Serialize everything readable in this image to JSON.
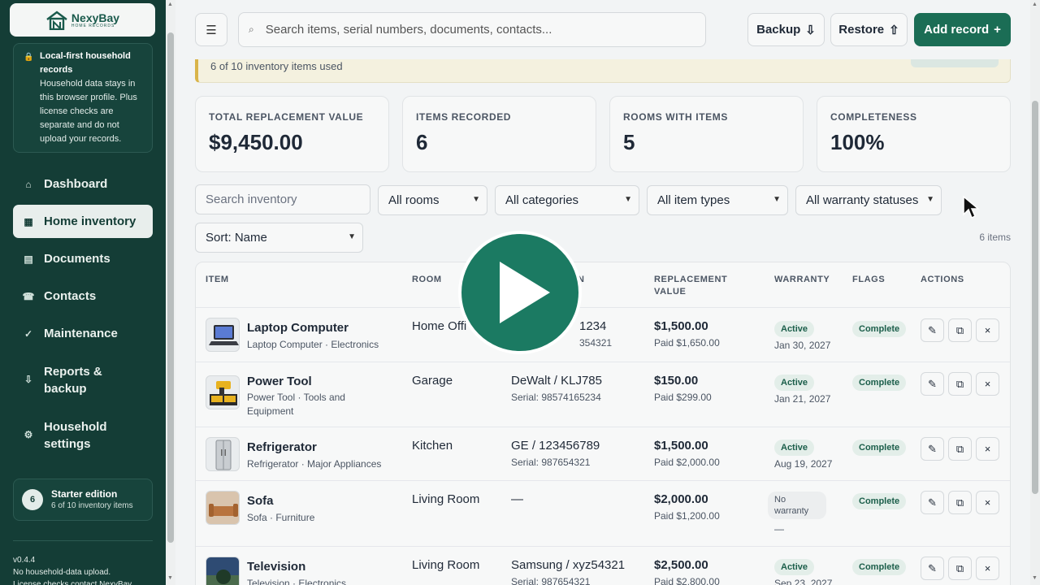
{
  "brand": {
    "name": "NexyBay",
    "sub": "HOME RECORDS"
  },
  "notice": {
    "title": "Local-first household records",
    "body": "Household data stays in this browser profile. Plus license checks are separate and do not upload your records."
  },
  "nav": [
    {
      "label": "Dashboard",
      "icon": "⌂"
    },
    {
      "label": "Home inventory",
      "icon": "▦",
      "active": true
    },
    {
      "label": "Documents",
      "icon": "▤"
    },
    {
      "label": "Contacts",
      "icon": "☎"
    },
    {
      "label": "Maintenance",
      "icon": "✓"
    },
    {
      "label": "Reports & backup",
      "icon": "⇩"
    },
    {
      "label": "Household settings",
      "icon": "⚙"
    }
  ],
  "edition": {
    "badge": "6",
    "title": "Starter edition",
    "sub": "6 of 10 inventory items"
  },
  "footer": {
    "version": "v0.4.4",
    "line1": "No household-data upload.",
    "line2": "License checks contact NexyBay."
  },
  "topbar": {
    "search_placeholder": "Search items, serial numbers, documents, contacts...",
    "backup": "Backup",
    "backup_icon": "⇩",
    "restore": "Restore",
    "restore_icon": "⇧",
    "add": "Add record",
    "add_icon": "+"
  },
  "banner": {
    "text": "6 of 10 inventory items used"
  },
  "stats": [
    {
      "label": "TOTAL REPLACEMENT VALUE",
      "value": "$9,450.00"
    },
    {
      "label": "ITEMS RECORDED",
      "value": "6"
    },
    {
      "label": "ROOMS WITH ITEMS",
      "value": "5"
    },
    {
      "label": "COMPLETENESS",
      "value": "100%"
    }
  ],
  "filters": {
    "search_placeholder": "Search inventory",
    "rooms": "All rooms",
    "categories": "All categories",
    "types": "All item types",
    "warranty": "All warranty statuses",
    "sort": "Sort: Name",
    "count": "6 items"
  },
  "table": {
    "headers": {
      "item": "ITEM",
      "room": "ROOM",
      "make": "N",
      "value1": "REPLACEMENT",
      "value2": "VALUE",
      "warranty": "WARRANTY",
      "flags": "FLAGS",
      "actions": "ACTIONS"
    },
    "rows": [
      {
        "name": "Laptop Computer",
        "sub": "Laptop Computer · Electronics",
        "room": "Home Offi",
        "mm": "1234",
        "serial": "354321",
        "value": "$1,500.00",
        "paid": "Paid $1,650.00",
        "warranty": "Active",
        "wdate": "Jan 30, 2027",
        "flag": "Complete"
      },
      {
        "name": "Power Tool",
        "sub": "Power Tool · Tools and Equipment",
        "room": "Garage",
        "mm": "DeWalt / KLJ785",
        "serial": "Serial: 98574165234",
        "value": "$150.00",
        "paid": "Paid $299.00",
        "warranty": "Active",
        "wdate": "Jan 21, 2027",
        "flag": "Complete"
      },
      {
        "name": "Refrigerator",
        "sub": "Refrigerator · Major Appliances",
        "room": "Kitchen",
        "mm": "GE / 123456789",
        "serial": "Serial: 987654321",
        "value": "$1,500.00",
        "paid": "Paid $2,000.00",
        "warranty": "Active",
        "wdate": "Aug 19, 2027",
        "flag": "Complete"
      },
      {
        "name": "Sofa",
        "sub": "Sofa · Furniture",
        "room": "Living Room",
        "mm": "—",
        "serial": "",
        "value": "$2,000.00",
        "paid": "Paid $1,200.00",
        "warranty": "No warranty",
        "wdate": "—",
        "flag": "Complete"
      },
      {
        "name": "Television",
        "sub": "Television · Electronics",
        "room": "Living Room",
        "mm": "Samsung / xyz54321",
        "serial": "Serial: 987654321",
        "value": "$2,500.00",
        "paid": "Paid $2,800.00",
        "warranty": "Active",
        "wdate": "Sep 23, 2027",
        "flag": "Complete"
      }
    ]
  },
  "actions": {
    "edit": "✎",
    "duplicate": "⧉",
    "delete": "×"
  },
  "colors": {
    "sidebar": "#143d36",
    "accent": "#1b6d55",
    "banner_border": "#d9b44a"
  }
}
